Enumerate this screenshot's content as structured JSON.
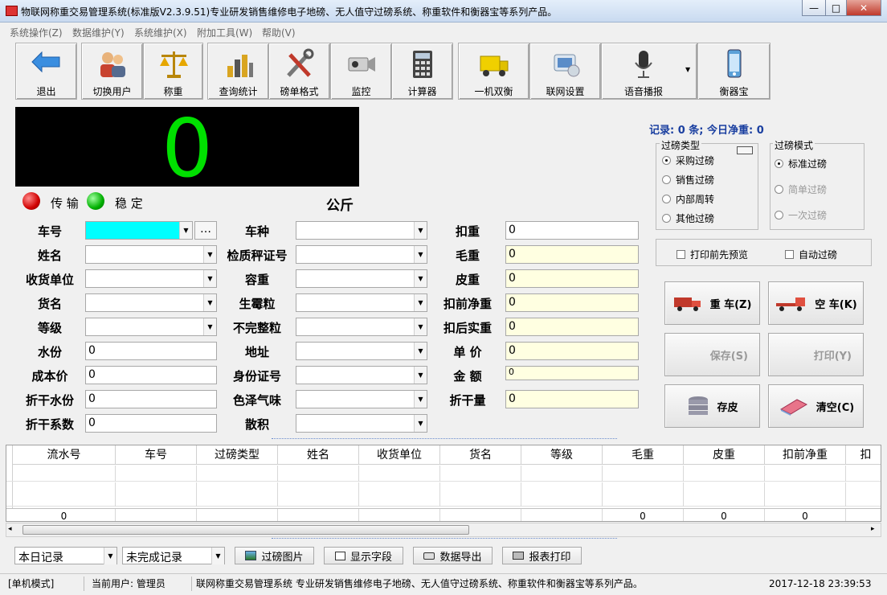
{
  "window": {
    "title": "物联网称重交易管理系统(标准版V2.3.9.51)专业研发销售维修电子地磅、无人值守过磅系统、称重软件和衡器宝等系列产品。",
    "min": "—",
    "max": "□",
    "close": "✕"
  },
  "menu": [
    "系统操作(Z)",
    "数据维护(Y)",
    "系统维护(X)",
    "附加工具(W)",
    "帮助(V)"
  ],
  "toolbar": [
    {
      "label": "退出",
      "icon": "exit-arrow-icon"
    },
    {
      "label": "切换用户",
      "icon": "users-icon"
    },
    {
      "label": "称重",
      "icon": "scale-icon"
    },
    {
      "label": "查询统计",
      "icon": "chart-icon"
    },
    {
      "label": "磅单格式",
      "icon": "tools-icon"
    },
    {
      "label": "监控",
      "icon": "camera-icon"
    },
    {
      "label": "计算器",
      "icon": "calculator-icon"
    },
    {
      "label": "一机双衡",
      "icon": "truck-icon"
    },
    {
      "label": "联网设置",
      "icon": "network-icon"
    },
    {
      "label": "语音播报",
      "icon": "microphone-icon"
    },
    {
      "label": "衡器宝",
      "icon": "phone-icon"
    }
  ],
  "display": {
    "value": "0",
    "unit": "公斤",
    "transfer": "传 输",
    "stable": "稳 定"
  },
  "record_summary": "记录: 0 条; 今日净重: 0",
  "weigh_type": {
    "title": "过磅类型",
    "options": [
      "采购过磅",
      "销售过磅",
      "内部周转",
      "其他过磅"
    ],
    "selected": 0
  },
  "weigh_mode": {
    "title": "过磅模式",
    "options": [
      "标准过磅",
      "简单过磅",
      "一次过磅"
    ],
    "selected": 0
  },
  "checks": {
    "preview": "打印前先预览",
    "auto": "自动过磅"
  },
  "form_left": [
    {
      "label": "车号",
      "type": "combo",
      "value": ""
    },
    {
      "label": "姓名",
      "type": "combo",
      "value": ""
    },
    {
      "label": "收货单位",
      "type": "combo",
      "value": ""
    },
    {
      "label": "货名",
      "type": "combo",
      "value": ""
    },
    {
      "label": "等级",
      "type": "combo",
      "value": ""
    },
    {
      "label": "水份",
      "type": "text",
      "value": "0"
    },
    {
      "label": "成本价",
      "type": "text",
      "value": "0"
    },
    {
      "label": "折干水份",
      "type": "text",
      "value": "0"
    },
    {
      "label": "折干系数",
      "type": "text",
      "value": "0"
    }
  ],
  "form_mid": [
    "车种",
    "检质秤证号",
    "容重",
    "生霉粒",
    "不完整粒",
    "地址",
    "身份证号",
    "色泽气味",
    "散积"
  ],
  "form_right": [
    {
      "label": "扣重",
      "value": "0"
    },
    {
      "label": "毛重",
      "value": "0"
    },
    {
      "label": "皮重",
      "value": "0"
    },
    {
      "label": "扣前净重",
      "value": "0"
    },
    {
      "label": "扣后实重",
      "value": "0"
    },
    {
      "label": "单 价",
      "value": "0"
    },
    {
      "label": "金 额",
      "value": "0"
    },
    {
      "label": "折干量",
      "value": "0"
    }
  ],
  "ellipsis": "…",
  "actions": {
    "heavy": "重 车(Z)",
    "empty": "空 车(K)",
    "save": "保存(S)",
    "print": "打印(Y)",
    "store_tare": "存皮",
    "clear": "清空(C)"
  },
  "grid": {
    "columns": [
      "流水号",
      "车号",
      "过磅类型",
      "姓名",
      "收货单位",
      "货名",
      "等级",
      "毛重",
      "皮重",
      "扣前净重",
      "扣"
    ],
    "totals": [
      "0",
      "",
      "",
      "",
      "",
      "",
      "",
      "0",
      "0",
      "0",
      ""
    ]
  },
  "bottom": {
    "period": "本日记录",
    "status": "未完成记录",
    "b1": "过磅图片",
    "b2": "显示字段",
    "b3": "数据导出",
    "b4": "报表打印"
  },
  "status": {
    "mode": "[单机模式]",
    "user": "当前用户: 管理员",
    "marquee": "联网称重交易管理系统  专业研发销售维修电子地磅、无人值守过磅系统、称重软件和衡器宝等系列产品。",
    "time": "2017-12-18 23:39:53"
  },
  "colors": {
    "display_bg": "#000000",
    "display_fg": "#00e000",
    "car_field": "#00ffff",
    "summary": "#1a3fa0",
    "led_red": "#d00000",
    "led_green": "#00b000"
  }
}
